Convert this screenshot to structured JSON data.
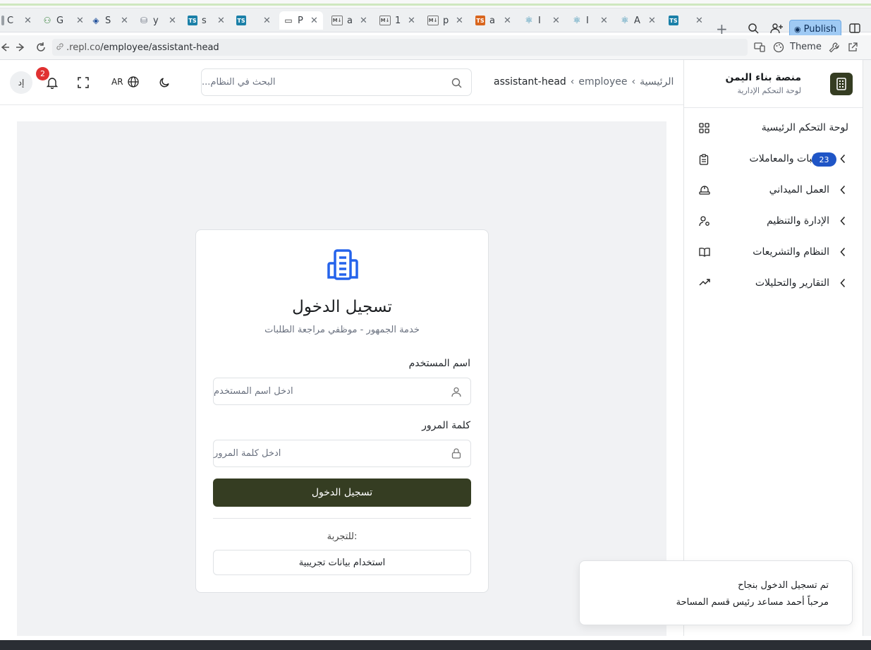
{
  "browser": {
    "tabs": [
      {
        "label": "C",
        "favicon": "generic"
      },
      {
        "label": "G",
        "favicon": "graph"
      },
      {
        "label": "S",
        "favicon": "shell"
      },
      {
        "label": "y",
        "favicon": "database"
      },
      {
        "label": "s",
        "favicon": "ts"
      },
      {
        "label": "",
        "favicon": "ts"
      },
      {
        "label": "P",
        "favicon": "monitor",
        "active": true
      },
      {
        "label": "a",
        "favicon": "markdown"
      },
      {
        "label": "1",
        "favicon": "markdown"
      },
      {
        "label": "p",
        "favicon": "markdown"
      },
      {
        "label": "a",
        "favicon": "ts-orange"
      },
      {
        "label": "I",
        "favicon": "react"
      },
      {
        "label": "I",
        "favicon": "react"
      },
      {
        "label": "A",
        "favicon": "react"
      },
      {
        "label": "",
        "favicon": "ts"
      }
    ],
    "publish_label": "Publish",
    "url_host": ".repl.co",
    "url_path": "/employee/assistant-head",
    "theme_label": "Theme"
  },
  "header": {
    "avatar_initials": "إد",
    "notification_count": "2",
    "language": "AR",
    "search_placeholder": "البحث في النظام...",
    "breadcrumb": {
      "home": "الرئيسية",
      "section": "employee",
      "current": "assistant-head"
    }
  },
  "login": {
    "title": "تسجيل الدخول",
    "subtitle": "خدمة الجمهور - موظفي مراجعة الطلبات",
    "username_label": "اسم المستخدم",
    "username_placeholder": "ادخل اسم المستخدم",
    "password_label": "كلمة المرور",
    "password_placeholder": "ادخل كلمة المرور",
    "submit_label": "تسجيل الدخول",
    "demo_label": "للتجربة:",
    "demo_button": "استخدام بيانات تجريبية"
  },
  "sidebar": {
    "brand_name": "منصة بناء اليمن",
    "brand_sub": "لوحة التحكم الإدارية",
    "items": [
      {
        "label": "لوحة التحكم الرئيسية",
        "icon": "grid-icon",
        "chevron": false
      },
      {
        "label": "الطلبات والمعاملات",
        "icon": "clipboard-icon",
        "chevron": true,
        "badge": "23"
      },
      {
        "label": "العمل الميداني",
        "icon": "hardhat-icon",
        "chevron": true
      },
      {
        "label": "الإدارة والتنظيم",
        "icon": "user-cog-icon",
        "chevron": true
      },
      {
        "label": "النظام والتشريعات",
        "icon": "book-icon",
        "chevron": true
      },
      {
        "label": "التقارير والتحليلات",
        "icon": "trending-icon",
        "chevron": true
      }
    ]
  },
  "toast": {
    "title": "تم تسجيل الدخول بنجاح",
    "description": "مرحباً أحمد مساعد رئيس قسم المساحة"
  },
  "colors": {
    "primary": "#353d22",
    "badge_blue": "#1f55c6",
    "notification_red": "#e03131",
    "login_icon_blue": "#2563eb"
  }
}
